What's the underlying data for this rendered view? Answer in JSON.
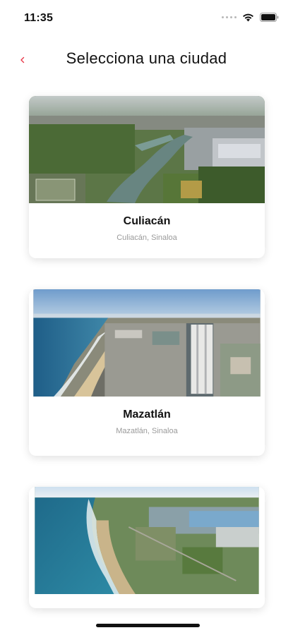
{
  "status_bar": {
    "time": "11:35"
  },
  "header": {
    "title": "Selecciona una ciudad",
    "back_color": "#e8394a"
  },
  "cities": [
    {
      "name": "Culiacán",
      "subtitle": "Culiacán, Sinaloa"
    },
    {
      "name": "Mazatlán",
      "subtitle": "Mazatlán, Sinaloa"
    },
    {
      "name": "",
      "subtitle": ""
    }
  ],
  "icons": [
    "chevron-left-icon",
    "wifi-icon",
    "battery-icon",
    "signal-icon"
  ]
}
